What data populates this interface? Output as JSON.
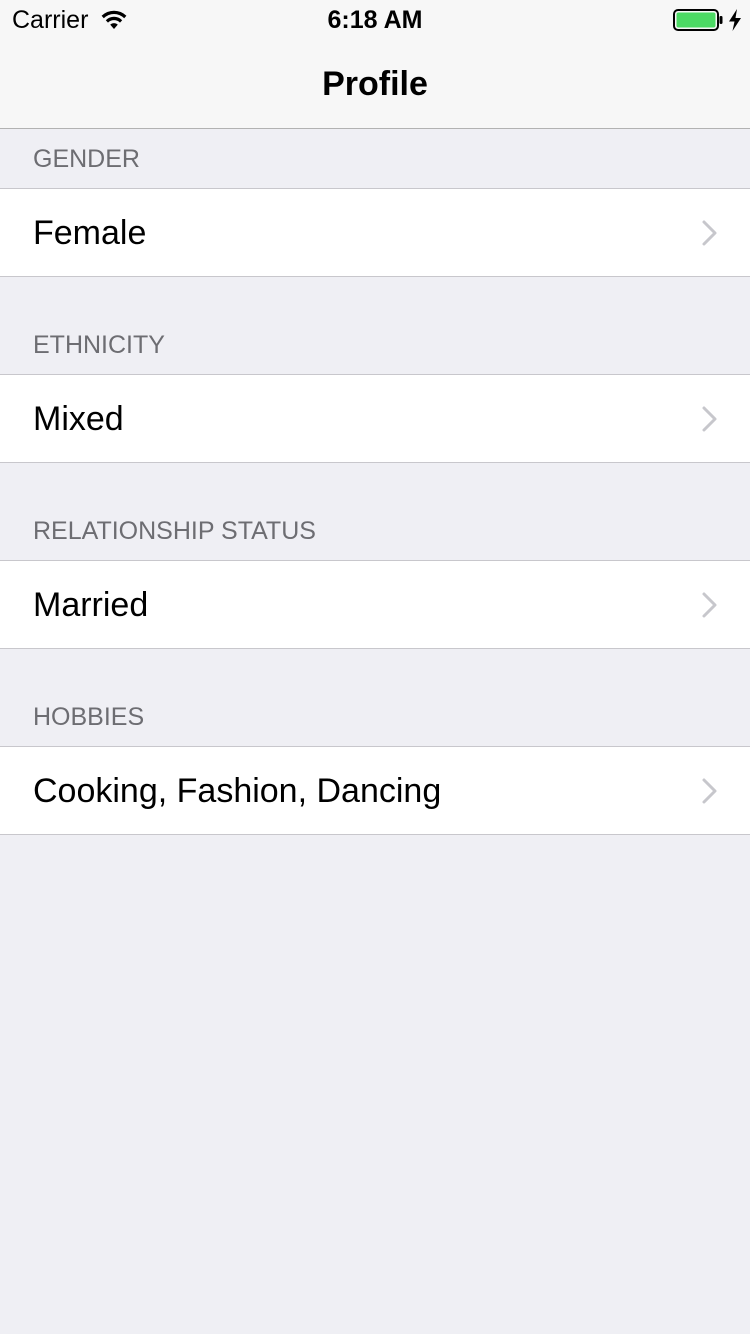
{
  "status_bar": {
    "carrier": "Carrier",
    "time": "6:18 AM",
    "wifi_icon": "wifi-icon",
    "battery_icon": "battery-charging-icon",
    "battery_color": "#4cd964"
  },
  "nav": {
    "title": "Profile"
  },
  "sections": [
    {
      "header": "GENDER",
      "value": "Female"
    },
    {
      "header": "ETHNICITY",
      "value": "Mixed"
    },
    {
      "header": "RELATIONSHIP STATUS",
      "value": "Married"
    },
    {
      "header": "HOBBIES",
      "value": "Cooking, Fashion, Dancing"
    }
  ],
  "colors": {
    "background": "#efeff4",
    "nav_background": "#f7f7f7",
    "section_header_text": "#6d6d72",
    "chevron": "#c7c7cc",
    "separator": "#c8c7cc"
  }
}
